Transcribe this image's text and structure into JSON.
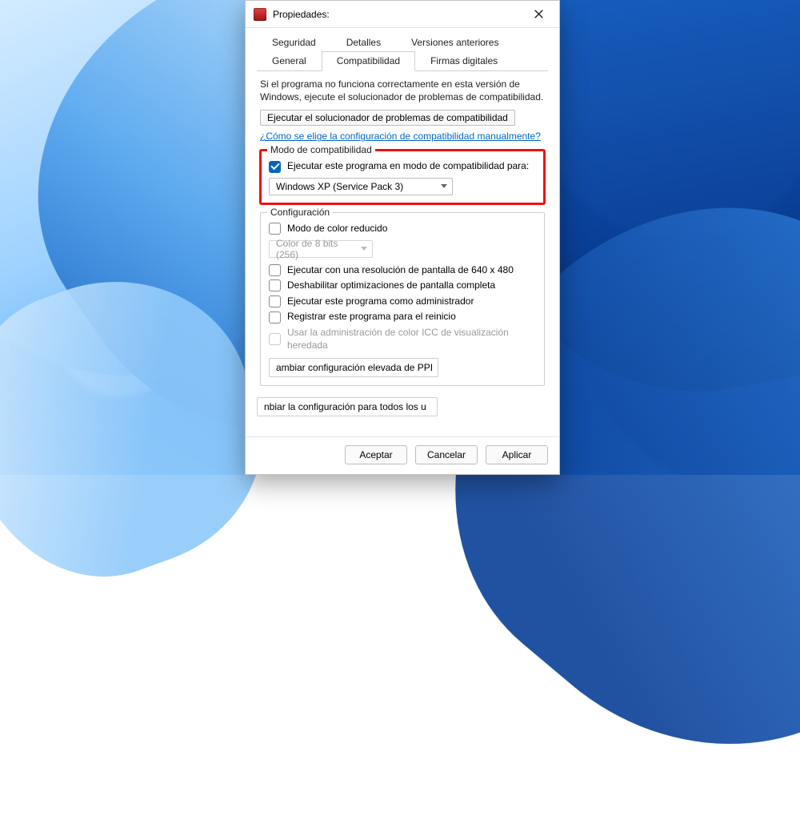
{
  "window": {
    "title": "Propiedades:"
  },
  "tabs": {
    "row1": [
      "Seguridad",
      "Detalles",
      "Versiones anteriores"
    ],
    "row2": [
      "General",
      "Compatibilidad",
      "Firmas digitales"
    ],
    "active": "Compatibilidad"
  },
  "body": {
    "desc": "Si el programa no funciona correctamente en esta versión de Windows, ejecute el solucionador de problemas de compatibilidad.",
    "troubleshooter_btn": "Ejecutar el solucionador de problemas de compatibilidad",
    "manual_link": "¿Cómo se elige la configuración de compatibilidad manualmente?"
  },
  "compat_mode": {
    "legend": "Modo de compatibilidad",
    "checkbox_label": "Ejecutar este programa en modo de compatibilidad para:",
    "checkbox_checked": true,
    "dropdown_value": "Windows XP (Service Pack 3)"
  },
  "settings": {
    "legend": "Configuración",
    "reduced_color_label": "Modo de color reducido",
    "reduced_color_value": "Color de 8 bits (256)",
    "res640_label": "Ejecutar con una resolución de pantalla de 640 x 480",
    "disable_fs_label": "Deshabilitar optimizaciones de pantalla completa",
    "run_admin_label": "Ejecutar este programa como administrador",
    "register_restart_label": "Registrar este programa para el reinicio",
    "icc_label": "Usar la administración de color ICC de visualización heredada",
    "dpi_btn": "ambiar configuración elevada de PPI"
  },
  "all_users_btn": "nbiar la configuración para todos los u",
  "footer": {
    "ok": "Aceptar",
    "cancel": "Cancelar",
    "apply": "Aplicar"
  }
}
